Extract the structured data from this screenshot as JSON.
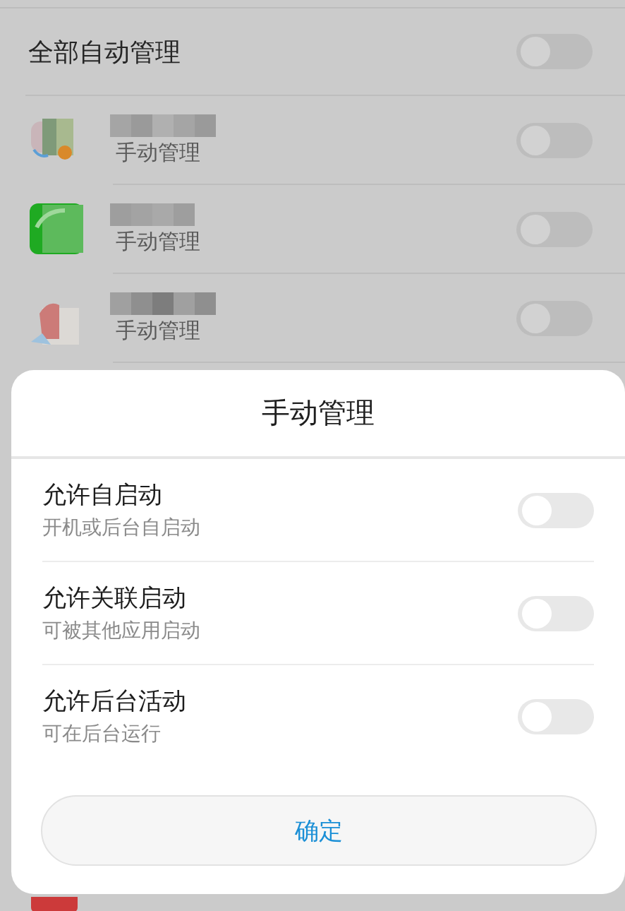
{
  "app_list": {
    "header": {
      "label": "全部自动管理",
      "on": false
    },
    "apps": [
      {
        "status": "手动管理",
        "on": false
      },
      {
        "status": "手动管理",
        "on": false
      },
      {
        "status": "手动管理",
        "on": false
      }
    ]
  },
  "dialog": {
    "title": "手动管理",
    "options": [
      {
        "label": "允许自启动",
        "description": "开机或后台自启动",
        "on": false
      },
      {
        "label": "允许关联启动",
        "description": "可被其他应用启动",
        "on": false
      },
      {
        "label": "允许后台活动",
        "description": "可在后台运行",
        "on": false
      }
    ],
    "confirm_button": "确定"
  }
}
